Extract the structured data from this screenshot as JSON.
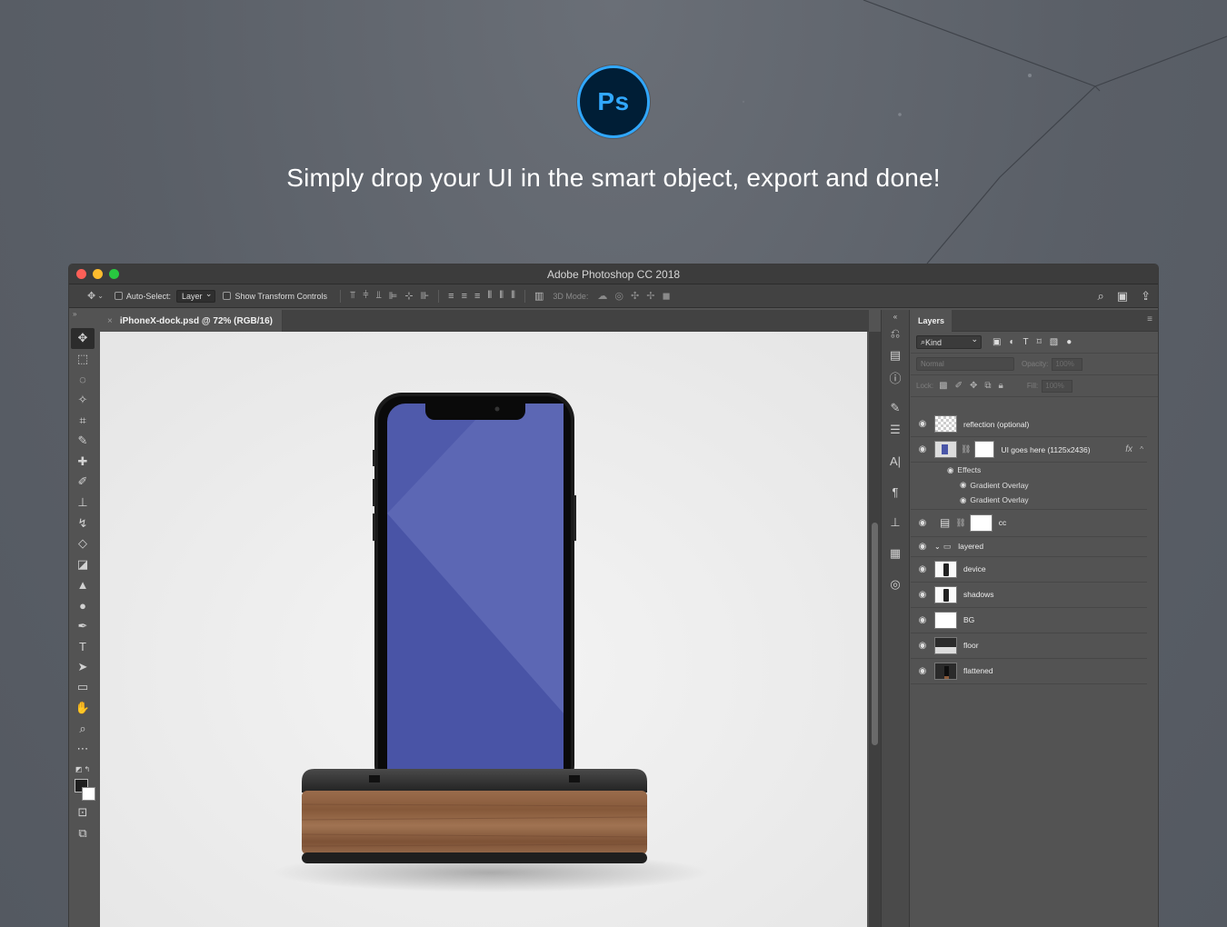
{
  "hero": {
    "logo_text": "Ps",
    "headline": "Simply drop your UI in the smart object, export and done!"
  },
  "window": {
    "title": "Adobe Photoshop CC 2018"
  },
  "options_bar": {
    "auto_select_label": "Auto-Select:",
    "auto_select_value": "Layer",
    "show_transform_label": "Show Transform Controls",
    "mode_3d_label": "3D Mode:"
  },
  "document": {
    "tab_title": "iPhoneX-dock.psd @ 72% (RGB/16)"
  },
  "layers_panel": {
    "tab_label": "Layers",
    "filter_kind": "Kind",
    "blend_mode": "Normal",
    "opacity_label": "Opacity:",
    "opacity_value": "100%",
    "lock_label": "Lock:",
    "fill_label": "Fill:",
    "fill_value": "100%",
    "layers": [
      {
        "name": "reflection (optional)"
      },
      {
        "name": "UI goes here (1125x2436)",
        "fx": "fx"
      },
      {
        "name": "cc"
      },
      {
        "name": "layered"
      },
      {
        "name": "device"
      },
      {
        "name": "shadows"
      },
      {
        "name": "BG"
      },
      {
        "name": "floor"
      },
      {
        "name": "flattened"
      }
    ],
    "effects_label": "Effects",
    "effects": [
      "Gradient Overlay",
      "Gradient Overlay"
    ]
  },
  "colors": {
    "accent": "#31a8ff",
    "logo_bg": "#001e36",
    "screen": "#4f5aab"
  }
}
